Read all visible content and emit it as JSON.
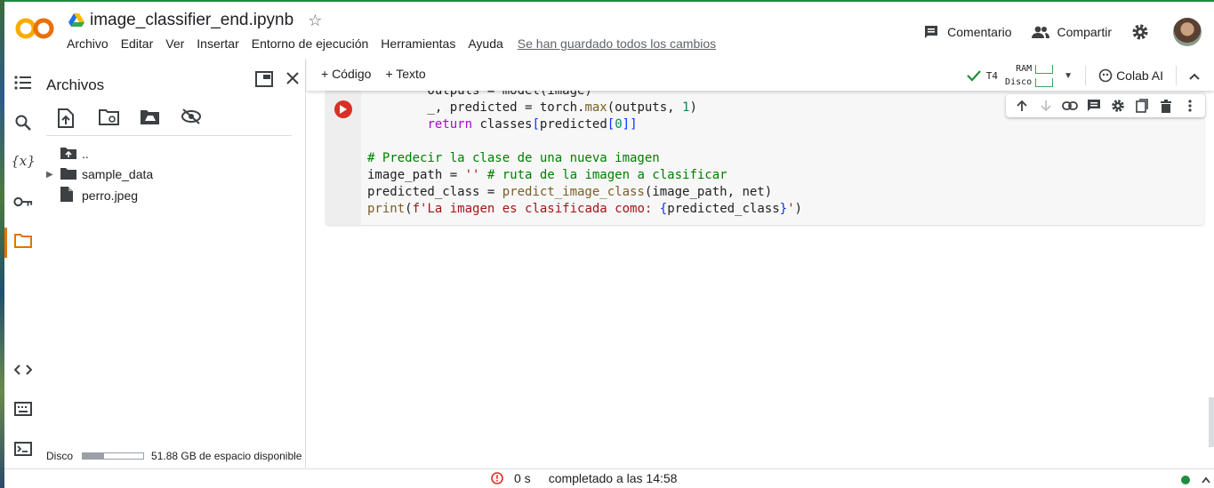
{
  "header": {
    "doc_title": "image_classifier_end.ipynb",
    "menu": [
      "Archivo",
      "Editar",
      "Ver",
      "Insertar",
      "Entorno de ejecución",
      "Herramientas",
      "Ayuda"
    ],
    "saved_status": "Se han guardado todos los cambios",
    "comment_label": "Comentario",
    "share_label": "Compartir"
  },
  "files_panel": {
    "title": "Archivos",
    "tree": [
      {
        "name": "..",
        "type": "parent-folder"
      },
      {
        "name": "sample_data",
        "type": "folder"
      },
      {
        "name": "perro.jpeg",
        "type": "file"
      }
    ],
    "disk_label": "Disco",
    "disk_free": "51.88 GB de espacio disponible",
    "disk_used_fraction": 0.35
  },
  "toolbar": {
    "add_code": "+ Código",
    "add_text": "+ Texto",
    "runtime": "T4",
    "ram_label": "RAM",
    "disk_label": "Disco",
    "colab_ai": "Colab AI"
  },
  "cell": {
    "lines": [
      "        outputs = model(image)",
      "        _, predicted = torch.max(outputs, 1)",
      "        return classes[predicted[0]]",
      "",
      "# Predecir la clase de una nueva imagen",
      "image_path = '' # ruta de la imagen a clasificar",
      "predicted_class = predict_image_class(image_path, net)",
      "print(f'La imagen es clasificada como: {predicted_class}')"
    ]
  },
  "status": {
    "duration": "0 s",
    "completed": "completado a las 14:58"
  },
  "colors": {
    "accent_orange": "#e37400",
    "run_red": "#d93025",
    "ok_green": "#1e8e3e"
  }
}
